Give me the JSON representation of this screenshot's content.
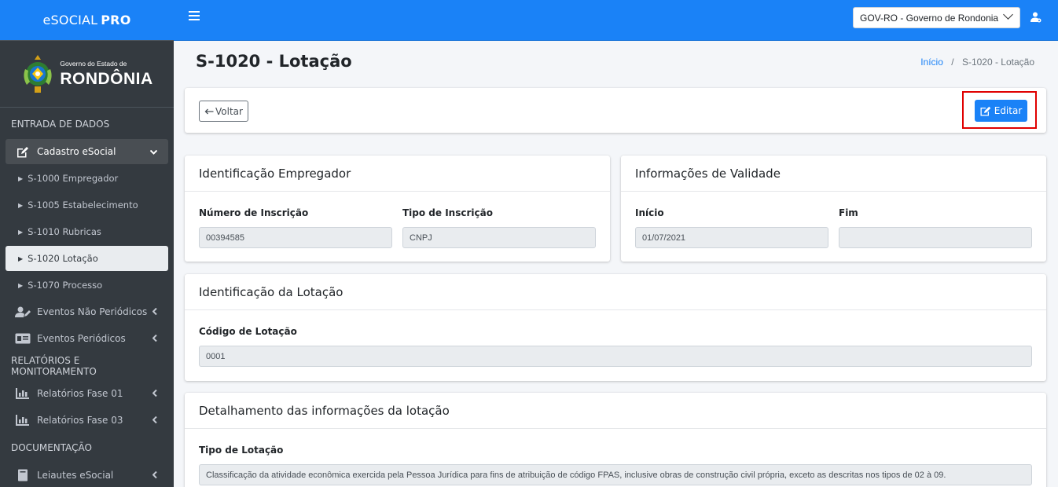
{
  "sidebar": {
    "brand_text": "eSOCIAL",
    "brand_bold": "PRO",
    "logo_small": "Governo do Estado de",
    "logo_big": "RONDÔNIA",
    "sections": {
      "entrada": "ENTRADA DE DADOS",
      "relatorios": "RELATÓRIOS E MONITORAMENTO",
      "documentacao": "DOCUMENTAÇÃO"
    },
    "cadastro_label": "Cadastro eSocial",
    "sub_items": [
      {
        "label": "S-1000 Empregador"
      },
      {
        "label": "S-1005 Estabelecimento"
      },
      {
        "label": "S-1010 Rubricas"
      },
      {
        "label": "S-1020 Lotação"
      },
      {
        "label": "S-1070 Processo"
      }
    ],
    "eventos_nao_periodicos": "Eventos Não Periódicos",
    "eventos_periodicos": "Eventos Periódicos",
    "relatorios_fase01": "Relatórios Fase 01",
    "relatorios_fase03": "Relatórios Fase 03",
    "leiautes": "Leiautes eSocial"
  },
  "topbar": {
    "org_selected": "GOV-RO - Governo de Rondonia"
  },
  "page": {
    "title": "S-1020 - Lotação",
    "breadcrumb_home": "Início",
    "breadcrumb_sep": "/",
    "breadcrumb_current": "S-1020 - Lotação",
    "back_label": "Voltar",
    "edit_label": "Editar"
  },
  "empregador": {
    "title": "Identificação Empregador",
    "numero_label": "Número de Inscrição",
    "numero_value": "00394585",
    "tipo_label": "Tipo de Inscrição",
    "tipo_value": "CNPJ"
  },
  "validade": {
    "title": "Informações de Validade",
    "inicio_label": "Início",
    "inicio_value": "01/07/2021",
    "fim_label": "Fim",
    "fim_value": ""
  },
  "lotacao": {
    "title": "Identificação da Lotação",
    "codigo_label": "Código de Lotação",
    "codigo_value": "0001"
  },
  "detalhamento": {
    "title": "Detalhamento das informações da lotação",
    "tipo_label": "Tipo de Lotação",
    "tipo_value": "Classificação da atividade econômica exercida pela Pessoa Jurídica para fins de atribuição de código FPAS, inclusive obras de construção civil própria, exceto as descritas nos tipos de 02 à 09."
  },
  "colors": {
    "primary": "#1a82f7",
    "sidebar_bg": "#343a40",
    "highlight_border": "#e00000"
  }
}
